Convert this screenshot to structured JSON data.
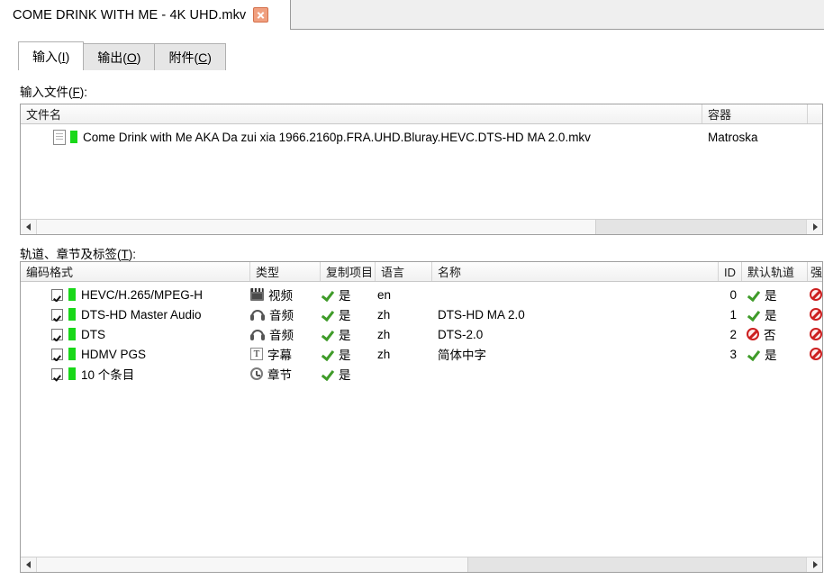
{
  "window": {
    "document_tab": {
      "title": "COME DRINK WITH ME - 4K UHD.mkv",
      "close_icon": "close-icon"
    }
  },
  "tabs": [
    {
      "label": "输入(I)",
      "active": true
    },
    {
      "label": "输出(O)",
      "active": false
    },
    {
      "label": "附件(C)",
      "active": false
    }
  ],
  "input_files": {
    "label": "输入文件(F):",
    "columns": [
      "文件名",
      "容器"
    ],
    "rows": [
      {
        "file_icon": "file-icon",
        "status_icon": "green-bar-icon",
        "filename": "Come Drink with Me AKA Da zui xia 1966.2160p.FRA.UHD.Bluray.HEVC.DTS-HD MA 2.0.mkv",
        "container": "Matroska"
      }
    ],
    "scrollbar": {
      "left_arrow": "scroll-left-icon",
      "right_arrow": "scroll-right-icon"
    }
  },
  "tracks": {
    "label": "轨道、章节及标签(T):",
    "columns": [
      "编码格式",
      "类型",
      "复制项目",
      "语言",
      "名称",
      "ID",
      "默认轨道",
      "强"
    ],
    "rows": [
      {
        "checked": true,
        "codec": "HEVC/H.265/MPEG-H",
        "type_icon": "video-icon",
        "type": "视频",
        "copy_icon": "check-icon",
        "copy": "是",
        "language": "en",
        "name": "",
        "id": "0",
        "default_icon": "check-icon",
        "default": "是",
        "forced_icon": "no-icon"
      },
      {
        "checked": true,
        "codec": "DTS-HD Master Audio",
        "type_icon": "audio-icon",
        "type": "音频",
        "copy_icon": "check-icon",
        "copy": "是",
        "language": "zh",
        "name": "DTS-HD MA 2.0",
        "id": "1",
        "default_icon": "check-icon",
        "default": "是",
        "forced_icon": "no-icon"
      },
      {
        "checked": true,
        "codec": "DTS",
        "type_icon": "audio-icon",
        "type": "音频",
        "copy_icon": "check-icon",
        "copy": "是",
        "language": "zh",
        "name": "DTS-2.0",
        "id": "2",
        "default_icon": "no-icon",
        "default": "否",
        "forced_icon": "no-icon"
      },
      {
        "checked": true,
        "codec": "HDMV PGS",
        "type_icon": "subtitle-icon",
        "type": "字幕",
        "copy_icon": "check-icon",
        "copy": "是",
        "language": "zh",
        "name": "简体中字",
        "id": "3",
        "default_icon": "check-icon",
        "default": "是",
        "forced_icon": "no-icon"
      },
      {
        "checked": true,
        "codec": "10 个条目",
        "type_icon": "chapter-icon",
        "type": "章节",
        "copy_icon": "check-icon",
        "copy": "是",
        "language": "",
        "name": "",
        "id": "",
        "default_icon": "",
        "default": "",
        "forced_icon": ""
      }
    ],
    "scrollbar": {
      "left_arrow": "scroll-left-icon",
      "right_arrow": "scroll-right-icon"
    }
  },
  "colors": {
    "accent_green": "#19d819",
    "check_green": "#3f9b29",
    "deny_red": "#cc1f1f",
    "close_orange": "#f0a080",
    "tab_inactive": "#e6e6e6",
    "panel_bg": "#efefef"
  }
}
